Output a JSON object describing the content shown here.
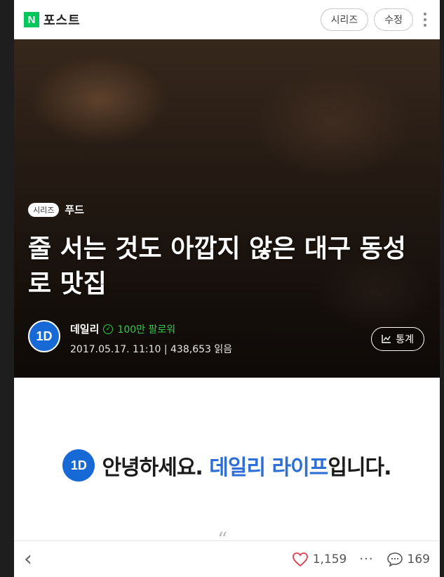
{
  "header": {
    "logo_letter": "N",
    "logo_text": "포스트",
    "series_button": "시리즈",
    "edit_button": "수정"
  },
  "hero": {
    "series_badge": "시리즈",
    "category": "푸드",
    "title": "줄 서는 것도 아깝지 않은 대구 동성로 맛집",
    "author": {
      "avatar_text": "1D",
      "name": "데일리",
      "followers": "100만 팔로워"
    },
    "meta": "2017.05.17. 11:10 | 438,653 읽음",
    "stats_button": "통계"
  },
  "content": {
    "greet_logo": "1D",
    "greeting_prefix": "안녕하세요.",
    "greeting_accent": "데일리 라이프",
    "greeting_suffix": "입니다.",
    "quote_mark": "“"
  },
  "bottom": {
    "back": "‹",
    "likes": "1,159",
    "more": "···",
    "comments": "169"
  },
  "colors": {
    "naver_green": "#03c75a",
    "brand_blue": "#2d6fd6",
    "follower_green": "#37c74e"
  }
}
